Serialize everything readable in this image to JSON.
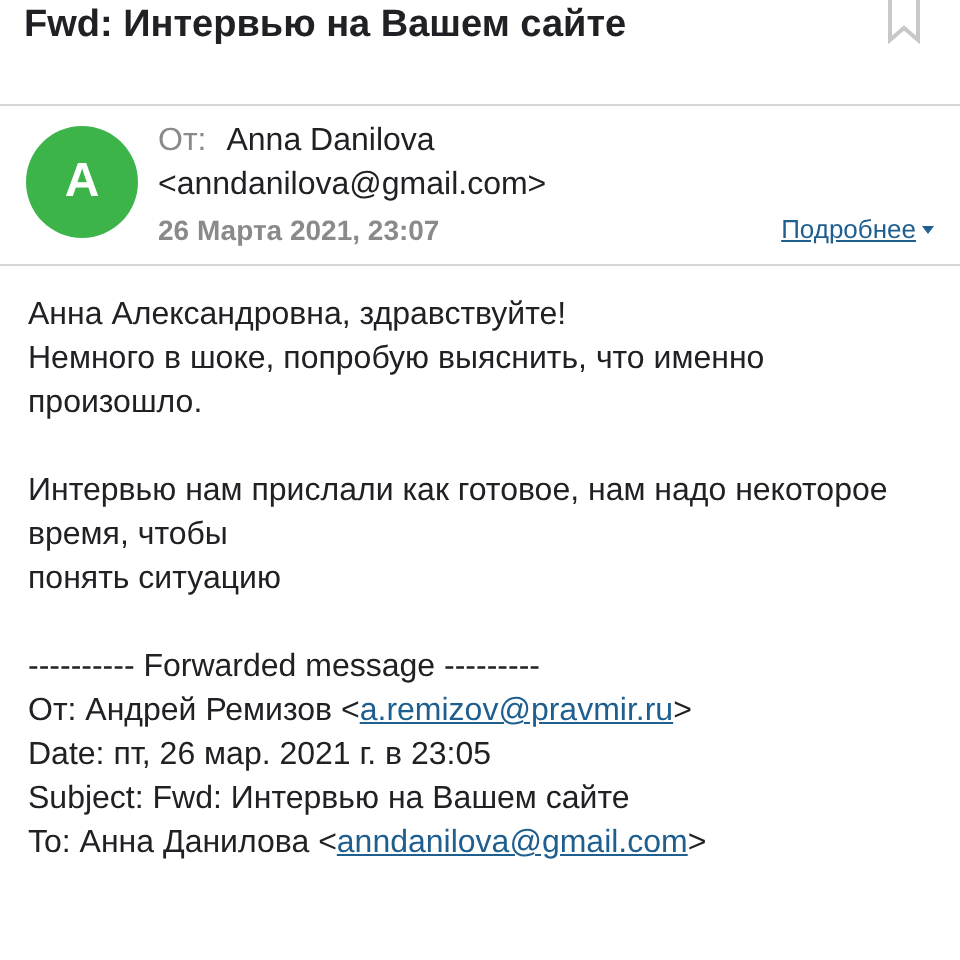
{
  "subject": "Fwd: Интервью на Вашем сайте",
  "sender": {
    "avatar_letter": "A",
    "from_label": "От:",
    "name": "Anna Danilova",
    "email": "<anndanilova@gmail.com>",
    "date": "26 Марта 2021, 23:07",
    "details_link": "Подробнее"
  },
  "body": [
    {
      "lines": [
        "Анна Александровна, здравствуйте!",
        "Немного в шоке, попробую выяснить, что именно произошло."
      ]
    },
    {
      "lines": [
        "Интервью нам прислали как готовое, нам надо некоторое время, чтобы",
        "понять ситуацию"
      ]
    }
  ],
  "forwarded": [
    {
      "before": "---------- Forwarded message ---------"
    },
    {
      "before": "От: Андрей Ремизов <",
      "link": "a.remizov@pravmir.ru",
      "after": ">"
    },
    {
      "before": "Date: пт, 26 мар. 2021 г. в 23:05"
    },
    {
      "before": "Subject: Fwd: Интервью на Вашем сайте"
    },
    {
      "before": "To: Анна Данилова <",
      "link": "anndanilova@gmail.com",
      "after": ">"
    }
  ]
}
